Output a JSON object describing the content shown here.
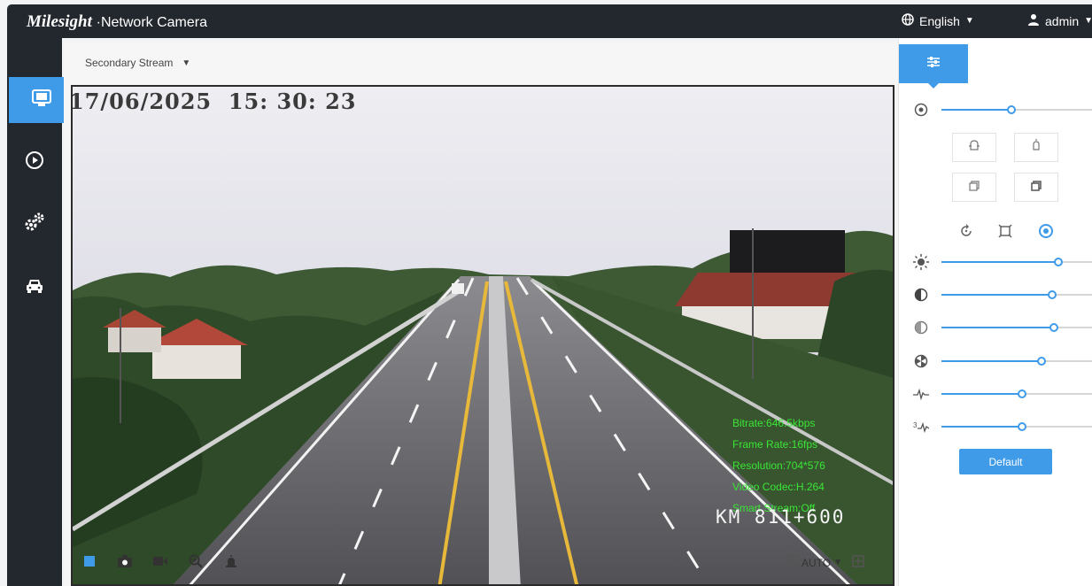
{
  "header": {
    "brand_logo": "Milesight",
    "product_name": "Network Camera",
    "language": "English",
    "user": "admin"
  },
  "sidebar": {
    "items": [
      {
        "name": "live-view",
        "icon": "monitor-icon",
        "active": true
      },
      {
        "name": "playback",
        "icon": "play-circle-icon",
        "active": false
      },
      {
        "name": "settings",
        "icon": "gears-icon",
        "active": false
      },
      {
        "name": "vehicle",
        "icon": "car-icon",
        "active": false
      }
    ]
  },
  "stream": {
    "selected": "Secondary Stream"
  },
  "video": {
    "osd_timestamp": "17/06/2025  15: 30: 23",
    "info": {
      "bitrate": "Bitrate:646.5kbps",
      "frame_rate": "Frame Rate:16fps",
      "resolution": "Resolution:704*576",
      "codec": "Video Codec:H.264",
      "smart_stream": "Smart Stream:Off"
    },
    "km_marker": "KM 811+600"
  },
  "toolbar": {
    "icons": [
      "stop-icon",
      "snapshot-icon",
      "record-icon",
      "zoom-icon",
      "alarm-icon"
    ],
    "zoom_mode": "AUTO"
  },
  "image_panel": {
    "sliders": [
      {
        "name": "focus",
        "icon": "focus-icon",
        "value": 0.46
      },
      {
        "name": "brightness",
        "icon": "sun-icon",
        "value": 0.77
      },
      {
        "name": "contrast",
        "icon": "contrast-icon",
        "value": 0.73
      },
      {
        "name": "saturation",
        "icon": "saturation-icon",
        "value": 0.74
      },
      {
        "name": "sharpness",
        "icon": "sharpness-icon",
        "value": 0.66
      },
      {
        "name": "noise-reduction-2d",
        "icon": "noise-2d-icon",
        "value": 0.53
      },
      {
        "name": "noise-reduction-3d",
        "icon": "noise-3d-icon",
        "value": 0.53
      }
    ],
    "default_label": "Default",
    "accent": "#3f9be8"
  }
}
